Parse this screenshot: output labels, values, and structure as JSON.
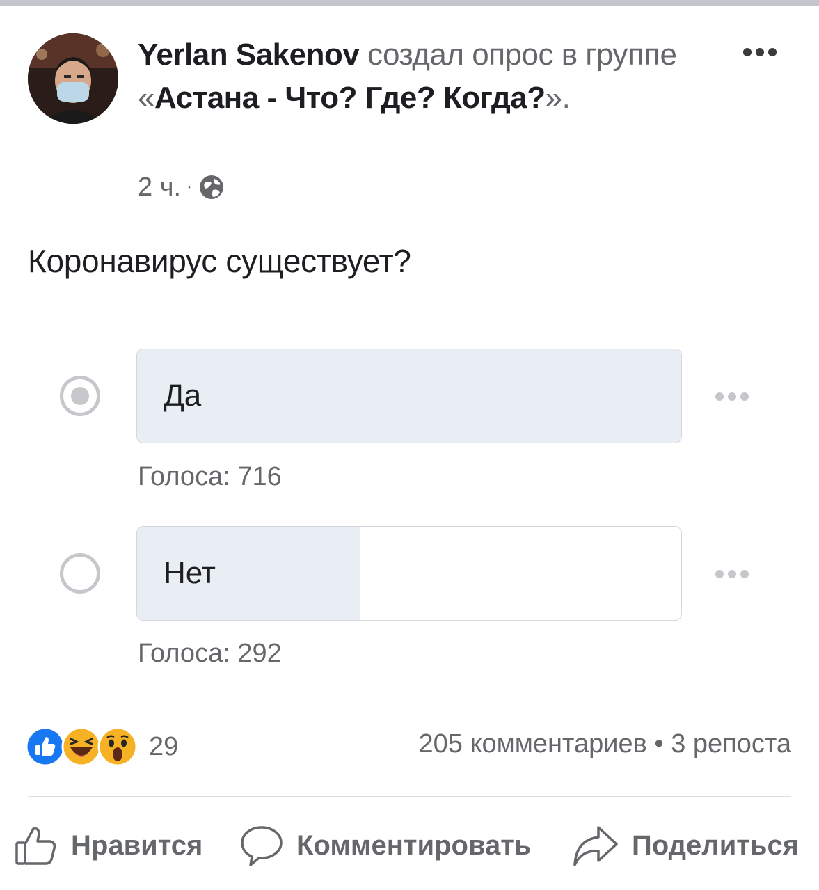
{
  "post": {
    "author": "Yerlan Sakenov",
    "action_text": " создал опрос в группе «",
    "group": "Астана - Что? Где? Когда?",
    "end_text": "».",
    "time": "2 ч.",
    "separator": "·",
    "privacy_icon": "globe-icon",
    "more_icon": "more-horizontal-icon"
  },
  "poll": {
    "question": "Коронавирус существует?",
    "options": [
      {
        "label": "Да",
        "votes_text": "Голоса: 716",
        "votes": 716,
        "selected": true,
        "fill_percent": 100
      },
      {
        "label": "Нет",
        "votes_text": "Голоса: 292",
        "votes": 292,
        "selected": false,
        "fill_percent": 41
      }
    ]
  },
  "engagement": {
    "reaction_icons": [
      "like-reaction-icon",
      "haha-reaction-icon",
      "wow-reaction-icon"
    ],
    "reaction_count": "29",
    "stats_text": "205 комментариев • 3 репоста"
  },
  "actions": {
    "like": "Нравится",
    "comment": "Комментировать",
    "share": "Поделиться"
  },
  "colors": {
    "text": "#1c1e21",
    "muted": "#65676b",
    "poll_fill": "#e9edf4",
    "like_blue": "#1877f2",
    "reaction_yellow": "#f7b125"
  }
}
